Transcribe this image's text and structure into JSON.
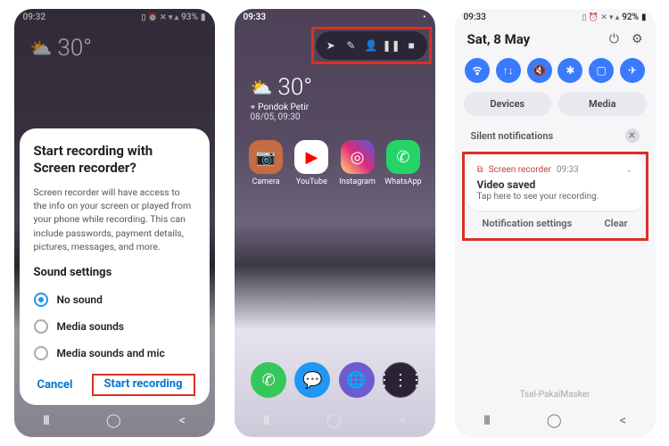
{
  "panel1": {
    "status": {
      "time": "09:32",
      "battery": "93%"
    },
    "weather": {
      "temp": "30°"
    },
    "dialog": {
      "title": "Start recording with Screen recorder?",
      "body": "Screen recorder will have access to the info on your screen or played from your phone while recording. This can include passwords, payment details, pictures, messages, and more.",
      "sound_settings_title": "Sound settings",
      "options": {
        "no_sound": "No sound",
        "media_sounds": "Media sounds",
        "media_sounds_mic": "Media sounds and mic"
      },
      "cancel": "Cancel",
      "start": "Start recording"
    }
  },
  "panel2": {
    "status": {
      "time": "09:33"
    },
    "weather": {
      "temp": "30°",
      "location": "Pondok Petir",
      "date": "08/05, 09:30"
    },
    "apps": {
      "camera": "Camera",
      "youtube": "YouTube",
      "instagram": "Instagram",
      "whatsapp": "WhatsApp"
    }
  },
  "panel3": {
    "status": {
      "time": "09:33",
      "battery": "92%"
    },
    "date": "Sat, 8 May",
    "chips": {
      "devices": "Devices",
      "media": "Media"
    },
    "silent_label": "Silent notifications",
    "notif": {
      "app": "Screen recorder",
      "time": "09:33",
      "title": "Video saved",
      "subtitle": "Tap here to see your recording."
    },
    "actions": {
      "settings": "Notification settings",
      "clear": "Clear"
    },
    "carrier": "Tsel-PakaiMasker"
  }
}
